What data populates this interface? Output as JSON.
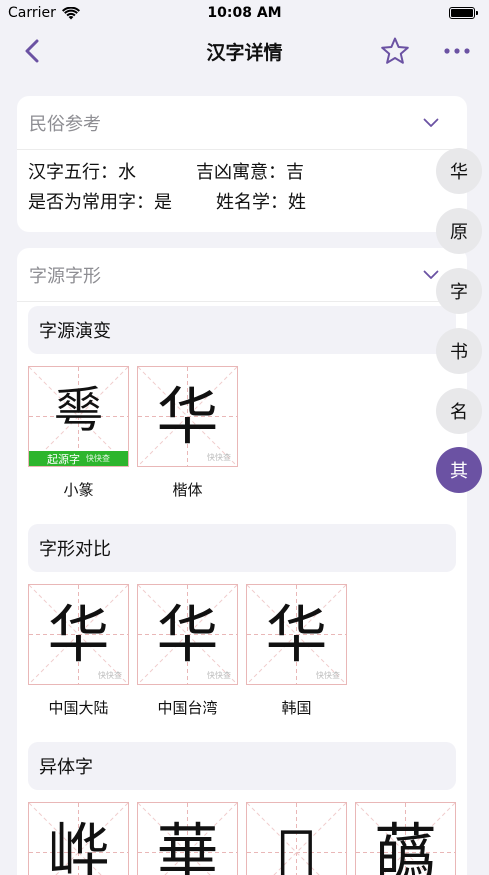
{
  "status_bar": {
    "carrier": "Carrier",
    "time": "10:08 AM"
  },
  "nav": {
    "title": "汉字详情",
    "back_icon": "chevron-left-icon",
    "favorite_icon": "star-outline-icon",
    "more_icon": "ellipsis-icon"
  },
  "colors": {
    "accent": "#6b52a3",
    "badge_green": "#2db52d",
    "grid_red": "#e9b7b7"
  },
  "folk": {
    "title": "民俗参考",
    "rows": [
      [
        {
          "label": "汉字五行：",
          "value": "水"
        },
        {
          "label": "吉凶寓意：",
          "value": "吉"
        }
      ],
      [
        {
          "label": "是否为常用字：",
          "value": "是"
        },
        {
          "label": "姓名学：",
          "value": "姓"
        }
      ]
    ]
  },
  "origin": {
    "title": "字源字形",
    "evolution": {
      "title": "字源演变",
      "items": [
        {
          "char": "𠌶",
          "label": "小篆",
          "badge": "起源字",
          "watermark": "快快查"
        },
        {
          "char": "华",
          "label": "楷体",
          "watermark": "快快查"
        }
      ]
    },
    "compare": {
      "title": "字形对比",
      "items": [
        {
          "char": "华",
          "label": "中国大陆",
          "watermark": "快快查"
        },
        {
          "char": "华",
          "label": "中国台湾",
          "watermark": "快快查"
        },
        {
          "char": "华",
          "label": "韩国",
          "watermark": "快快查"
        }
      ]
    },
    "variants": {
      "title": "异体字",
      "items": [
        {
          "char": "㟆"
        },
        {
          "char": "華"
        },
        {
          "char": "𦻏"
        },
        {
          "char": "蘤"
        }
      ]
    }
  },
  "side_index": [
    "华",
    "原",
    "字",
    "书",
    "名",
    "其"
  ],
  "side_index_active": "其"
}
